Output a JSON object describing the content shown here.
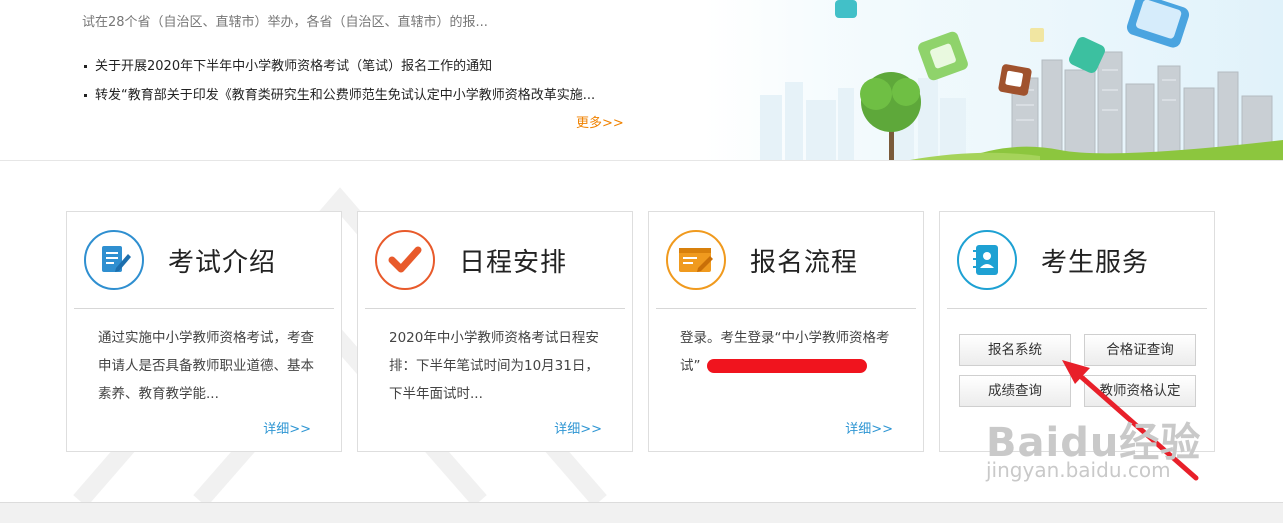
{
  "banner": {
    "intro": "试在28个省（自治区、直辖市）举办，各省（自治区、直辖市）的报...",
    "news": [
      "关于开展2020年下半年中小学教师资格考试（笔试）报名工作的通知",
      "转发“教育部关于印发《教育类研究生和公费师范生免试认定中小学教师资格改革实施..."
    ],
    "more": "更多>>"
  },
  "cards": [
    {
      "title": "考试介绍",
      "desc": "通过实施中小学教师资格考试，考查申请人是否具备教师职业道德、基本素养、教育教学能...",
      "detail": "详细>>",
      "accent": "#2f8fd0"
    },
    {
      "title": "日程安排",
      "desc": "2020年中小学教师资格考试日程安排：下半年笔试时间为10月31日，下半年面试时...",
      "detail": "详细>>",
      "accent": "#e85a2b"
    },
    {
      "title": "报名流程",
      "desc": "登录。考生登录“中小学教师资格考试”",
      "detail": "详细>>",
      "accent": "#f09a1e"
    },
    {
      "title": "考生服务",
      "accent": "#1ea1d3",
      "buttons": [
        "报名系统",
        "合格证查询",
        "成绩查询",
        "教师资格认定"
      ]
    }
  ],
  "watermark": {
    "logo": "Baidu经验",
    "sub": "jingyan.baidu.com"
  },
  "colors": {
    "link": "#2f96d3",
    "more": "#f08200",
    "annotation": "#e8202a"
  }
}
